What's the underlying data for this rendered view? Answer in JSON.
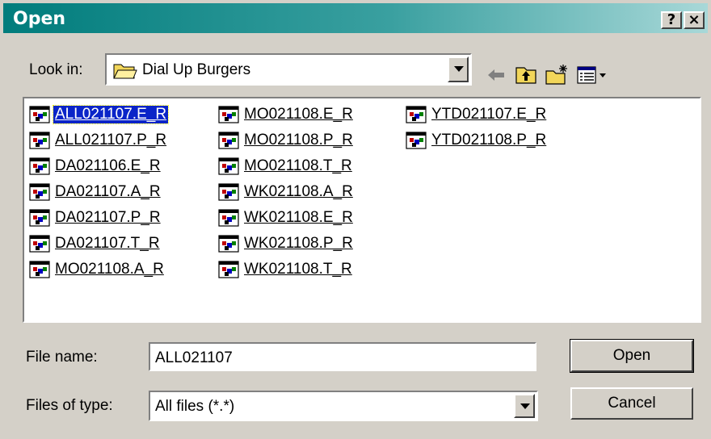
{
  "window": {
    "title": "Open",
    "help_glyph": "?",
    "close_glyph": "×"
  },
  "look_in": {
    "label": "Look in:",
    "value": "Dial Up Burgers"
  },
  "toolbar": [
    "back-icon",
    "up-folder-icon",
    "new-folder-icon",
    "view-menu-icon"
  ],
  "files": {
    "columns": [
      [
        "ALL021107.E_R",
        "ALL021107.P_R",
        "DA021106.E_R",
        "DA021107.A_R",
        "DA021107.P_R",
        "DA021107.T_R",
        "MO021108.A_R"
      ],
      [
        "MO021108.E_R",
        "MO021108.P_R",
        "MO021108.T_R",
        "WK021108.A_R",
        "WK021108.E_R",
        "WK021108.P_R",
        "WK021108.T_R"
      ],
      [
        "YTD021107.E_R",
        "YTD021108.P_R"
      ]
    ],
    "selected": "ALL021107.E_R"
  },
  "file_name": {
    "label": "File name:",
    "value": "ALL021107"
  },
  "file_type": {
    "label": "Files of type:",
    "value": "All files (*.*)"
  },
  "buttons": {
    "open": "Open",
    "cancel": "Cancel"
  }
}
